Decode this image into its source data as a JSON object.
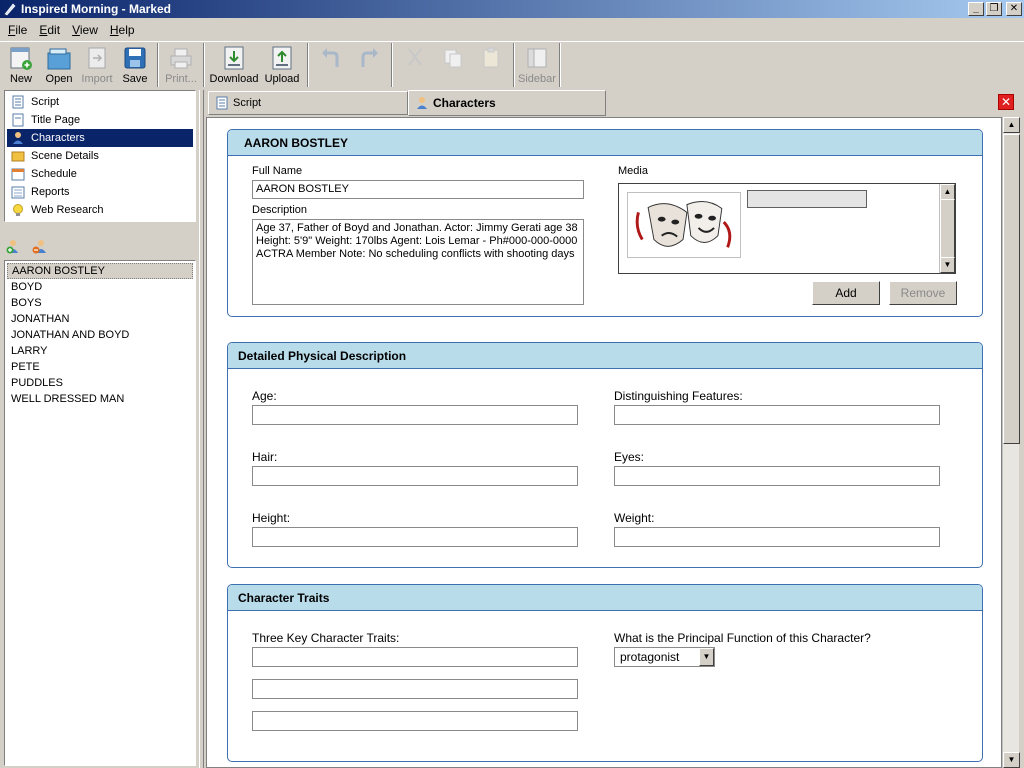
{
  "window": {
    "title": "Inspired Morning - Marked",
    "controls": [
      "_",
      "❐",
      "✕"
    ]
  },
  "menu": [
    {
      "label": "File",
      "key": "F",
      "rest": "ile"
    },
    {
      "label": "Edit",
      "key": "E",
      "rest": "dit"
    },
    {
      "label": "View",
      "key": "V",
      "rest": "iew"
    },
    {
      "label": "Help",
      "key": "H",
      "rest": "elp"
    }
  ],
  "toolbar": {
    "new": "New",
    "open": "Open",
    "import": "Import",
    "save": "Save",
    "print": "Print...",
    "download": "Download",
    "upload": "Upload",
    "sidebar": "Sidebar"
  },
  "nav": {
    "items": [
      {
        "label": "Script",
        "icon": "script-icon"
      },
      {
        "label": "Title Page",
        "icon": "title-page-icon"
      },
      {
        "label": "Characters",
        "icon": "characters-icon",
        "selected": true
      },
      {
        "label": "Scene Details",
        "icon": "scene-details-icon"
      },
      {
        "label": "Schedule",
        "icon": "schedule-icon"
      },
      {
        "label": "Reports",
        "icon": "reports-icon"
      },
      {
        "label": "Web Research",
        "icon": "web-research-icon"
      }
    ]
  },
  "characters": {
    "list": [
      "AARON BOSTLEY",
      "BOYD",
      "BOYS",
      "JONATHAN",
      "JONATHAN AND BOYD",
      "LARRY",
      "PETE",
      "PUDDLES",
      "WELL DRESSED MAN"
    ],
    "selected_index": 0
  },
  "tabs": [
    {
      "label": "Script",
      "active": false
    },
    {
      "label": "Characters",
      "active": true
    }
  ],
  "character_card": {
    "header": "AARON BOSTLEY",
    "full_name_label": "Full Name",
    "full_name_value": "AARON BOSTLEY",
    "description_label": "Description",
    "description_value": "Age 37, Father of Boyd and Jonathan. Actor: Jimmy Gerati age 38\nHeight: 5'9\" Weight: 170lbs Agent: Lois Lemar - Ph#000-000-0000\nACTRA Member Note: No scheduling conflicts with shooting days",
    "media_label": "Media",
    "add_button": "Add",
    "remove_button": "Remove"
  },
  "physical": {
    "header": "Detailed Physical Description",
    "age_label": "Age:",
    "features_label": "Distinguishing Features:",
    "hair_label": "Hair:",
    "eyes_label": "Eyes:",
    "height_label": "Height:",
    "weight_label": "Weight:",
    "age_value": "",
    "features_value": "",
    "hair_value": "",
    "eyes_value": "",
    "height_value": "",
    "weight_value": ""
  },
  "traits": {
    "header": "Character Traits",
    "traits_label": "Three Key Character Traits:",
    "trait_values": [
      "",
      "",
      ""
    ],
    "function_label": "What is the Principal Function of this Character?",
    "function_value": "protagonist"
  },
  "colors": {
    "section_header_bg": "#b9dcea",
    "section_border": "#3e6fb0",
    "selection": "#0a246a"
  }
}
